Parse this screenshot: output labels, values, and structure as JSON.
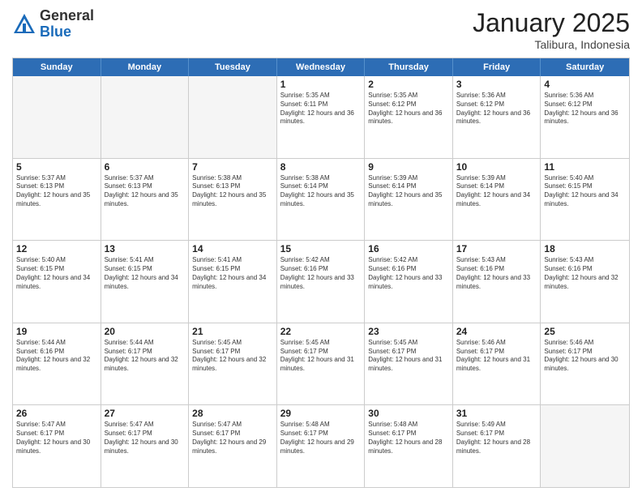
{
  "header": {
    "logo_general": "General",
    "logo_blue": "Blue",
    "month": "January 2025",
    "location": "Talibura, Indonesia"
  },
  "calendar": {
    "days": [
      "Sunday",
      "Monday",
      "Tuesday",
      "Wednesday",
      "Thursday",
      "Friday",
      "Saturday"
    ],
    "rows": [
      [
        {
          "day": "",
          "empty": true
        },
        {
          "day": "",
          "empty": true
        },
        {
          "day": "",
          "empty": true
        },
        {
          "day": "1",
          "sunrise": "Sunrise: 5:35 AM",
          "sunset": "Sunset: 6:11 PM",
          "daylight": "Daylight: 12 hours and 36 minutes."
        },
        {
          "day": "2",
          "sunrise": "Sunrise: 5:35 AM",
          "sunset": "Sunset: 6:12 PM",
          "daylight": "Daylight: 12 hours and 36 minutes."
        },
        {
          "day": "3",
          "sunrise": "Sunrise: 5:36 AM",
          "sunset": "Sunset: 6:12 PM",
          "daylight": "Daylight: 12 hours and 36 minutes."
        },
        {
          "day": "4",
          "sunrise": "Sunrise: 5:36 AM",
          "sunset": "Sunset: 6:12 PM",
          "daylight": "Daylight: 12 hours and 36 minutes."
        }
      ],
      [
        {
          "day": "5",
          "sunrise": "Sunrise: 5:37 AM",
          "sunset": "Sunset: 6:13 PM",
          "daylight": "Daylight: 12 hours and 35 minutes."
        },
        {
          "day": "6",
          "sunrise": "Sunrise: 5:37 AM",
          "sunset": "Sunset: 6:13 PM",
          "daylight": "Daylight: 12 hours and 35 minutes."
        },
        {
          "day": "7",
          "sunrise": "Sunrise: 5:38 AM",
          "sunset": "Sunset: 6:13 PM",
          "daylight": "Daylight: 12 hours and 35 minutes."
        },
        {
          "day": "8",
          "sunrise": "Sunrise: 5:38 AM",
          "sunset": "Sunset: 6:14 PM",
          "daylight": "Daylight: 12 hours and 35 minutes."
        },
        {
          "day": "9",
          "sunrise": "Sunrise: 5:39 AM",
          "sunset": "Sunset: 6:14 PM",
          "daylight": "Daylight: 12 hours and 35 minutes."
        },
        {
          "day": "10",
          "sunrise": "Sunrise: 5:39 AM",
          "sunset": "Sunset: 6:14 PM",
          "daylight": "Daylight: 12 hours and 34 minutes."
        },
        {
          "day": "11",
          "sunrise": "Sunrise: 5:40 AM",
          "sunset": "Sunset: 6:15 PM",
          "daylight": "Daylight: 12 hours and 34 minutes."
        }
      ],
      [
        {
          "day": "12",
          "sunrise": "Sunrise: 5:40 AM",
          "sunset": "Sunset: 6:15 PM",
          "daylight": "Daylight: 12 hours and 34 minutes."
        },
        {
          "day": "13",
          "sunrise": "Sunrise: 5:41 AM",
          "sunset": "Sunset: 6:15 PM",
          "daylight": "Daylight: 12 hours and 34 minutes."
        },
        {
          "day": "14",
          "sunrise": "Sunrise: 5:41 AM",
          "sunset": "Sunset: 6:15 PM",
          "daylight": "Daylight: 12 hours and 34 minutes."
        },
        {
          "day": "15",
          "sunrise": "Sunrise: 5:42 AM",
          "sunset": "Sunset: 6:16 PM",
          "daylight": "Daylight: 12 hours and 33 minutes."
        },
        {
          "day": "16",
          "sunrise": "Sunrise: 5:42 AM",
          "sunset": "Sunset: 6:16 PM",
          "daylight": "Daylight: 12 hours and 33 minutes."
        },
        {
          "day": "17",
          "sunrise": "Sunrise: 5:43 AM",
          "sunset": "Sunset: 6:16 PM",
          "daylight": "Daylight: 12 hours and 33 minutes."
        },
        {
          "day": "18",
          "sunrise": "Sunrise: 5:43 AM",
          "sunset": "Sunset: 6:16 PM",
          "daylight": "Daylight: 12 hours and 32 minutes."
        }
      ],
      [
        {
          "day": "19",
          "sunrise": "Sunrise: 5:44 AM",
          "sunset": "Sunset: 6:16 PM",
          "daylight": "Daylight: 12 hours and 32 minutes."
        },
        {
          "day": "20",
          "sunrise": "Sunrise: 5:44 AM",
          "sunset": "Sunset: 6:17 PM",
          "daylight": "Daylight: 12 hours and 32 minutes."
        },
        {
          "day": "21",
          "sunrise": "Sunrise: 5:45 AM",
          "sunset": "Sunset: 6:17 PM",
          "daylight": "Daylight: 12 hours and 32 minutes."
        },
        {
          "day": "22",
          "sunrise": "Sunrise: 5:45 AM",
          "sunset": "Sunset: 6:17 PM",
          "daylight": "Daylight: 12 hours and 31 minutes."
        },
        {
          "day": "23",
          "sunrise": "Sunrise: 5:45 AM",
          "sunset": "Sunset: 6:17 PM",
          "daylight": "Daylight: 12 hours and 31 minutes."
        },
        {
          "day": "24",
          "sunrise": "Sunrise: 5:46 AM",
          "sunset": "Sunset: 6:17 PM",
          "daylight": "Daylight: 12 hours and 31 minutes."
        },
        {
          "day": "25",
          "sunrise": "Sunrise: 5:46 AM",
          "sunset": "Sunset: 6:17 PM",
          "daylight": "Daylight: 12 hours and 30 minutes."
        }
      ],
      [
        {
          "day": "26",
          "sunrise": "Sunrise: 5:47 AM",
          "sunset": "Sunset: 6:17 PM",
          "daylight": "Daylight: 12 hours and 30 minutes."
        },
        {
          "day": "27",
          "sunrise": "Sunrise: 5:47 AM",
          "sunset": "Sunset: 6:17 PM",
          "daylight": "Daylight: 12 hours and 30 minutes."
        },
        {
          "day": "28",
          "sunrise": "Sunrise: 5:47 AM",
          "sunset": "Sunset: 6:17 PM",
          "daylight": "Daylight: 12 hours and 29 minutes."
        },
        {
          "day": "29",
          "sunrise": "Sunrise: 5:48 AM",
          "sunset": "Sunset: 6:17 PM",
          "daylight": "Daylight: 12 hours and 29 minutes."
        },
        {
          "day": "30",
          "sunrise": "Sunrise: 5:48 AM",
          "sunset": "Sunset: 6:17 PM",
          "daylight": "Daylight: 12 hours and 28 minutes."
        },
        {
          "day": "31",
          "sunrise": "Sunrise: 5:49 AM",
          "sunset": "Sunset: 6:17 PM",
          "daylight": "Daylight: 12 hours and 28 minutes."
        },
        {
          "day": "",
          "empty": true
        }
      ]
    ]
  }
}
